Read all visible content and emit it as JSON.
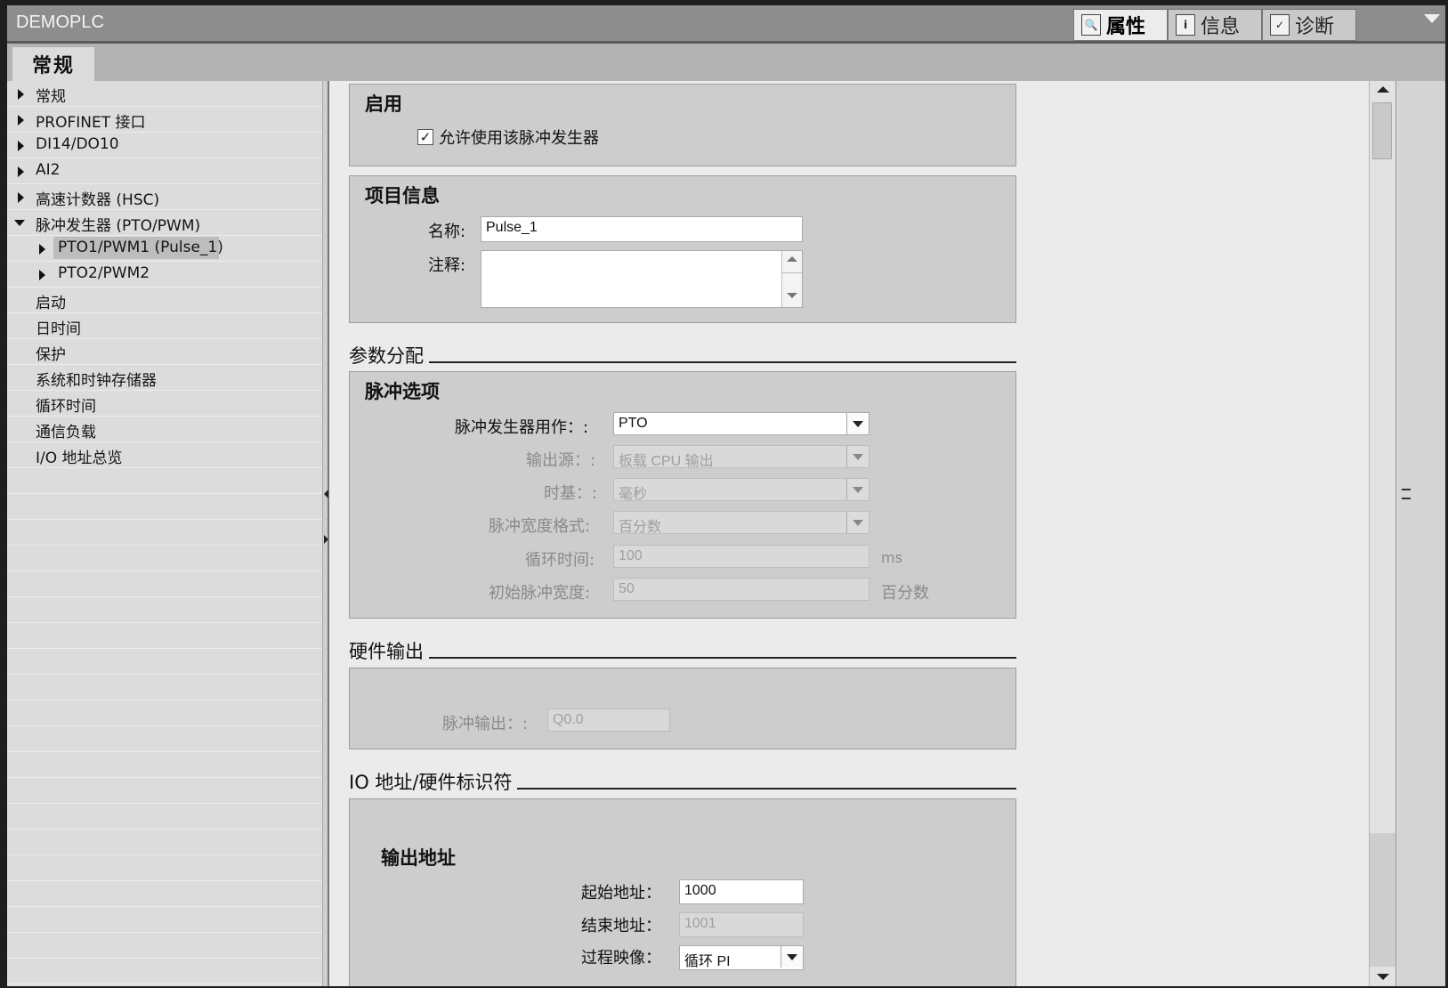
{
  "window": {
    "title": "DEMOPLC"
  },
  "inspector_tabs": [
    {
      "icon": "properties-icon",
      "label": "属性",
      "active": true
    },
    {
      "icon": "info-icon",
      "label": "信息",
      "active": false
    },
    {
      "icon": "diagnostics-icon",
      "label": "诊断",
      "active": false
    }
  ],
  "general_tab": {
    "label": "常规"
  },
  "sidebar": {
    "items": [
      {
        "label": "常规",
        "expander": "collapsed"
      },
      {
        "label": "PROFINET 接口",
        "expander": "collapsed"
      },
      {
        "label": "DI14/DO10",
        "expander": "collapsed"
      },
      {
        "label": "AI2",
        "expander": "collapsed"
      },
      {
        "label": "高速计数器 (HSC)",
        "expander": "collapsed"
      },
      {
        "label": "脉冲发生器 (PTO/PWM)",
        "expander": "expanded"
      },
      {
        "label": "PTO1/PWM1 (Pulse_1)",
        "expander": "collapsed",
        "selected": true
      },
      {
        "label": "PTO2/PWM2",
        "expander": "collapsed"
      },
      {
        "label": "启动"
      },
      {
        "label": "日时间"
      },
      {
        "label": "保护"
      },
      {
        "label": "系统和时钟存储器"
      },
      {
        "label": "循环时间"
      },
      {
        "label": "通信负载"
      },
      {
        "label": "I/O 地址总览"
      }
    ]
  },
  "enable_section": {
    "title": "启用",
    "checkbox_label": "允许使用该脉冲发生器",
    "checked": true
  },
  "project_info": {
    "title": "项目信息",
    "name_label": "名称:",
    "name_value": "Pulse_1",
    "comment_label": "注释:",
    "comment_value": ""
  },
  "parameter_assignment": {
    "header": "参数分配",
    "box_title": "脉冲选项",
    "fields": {
      "generator_use": {
        "label": "脉冲发生器用作：:",
        "value": "PTO"
      },
      "output_source": {
        "label": "输出源：:",
        "value": "板载 CPU 输出"
      },
      "time_base": {
        "label": "时基：:",
        "value": "毫秒"
      },
      "pulse_width_format": {
        "label": "脉冲宽度格式:",
        "value": "百分数"
      },
      "cycle_time": {
        "label": "循环时间:",
        "value": "100",
        "unit": "ms"
      },
      "initial_pulse_width": {
        "label": "初始脉冲宽度:",
        "value": "50",
        "unit": "百分数"
      }
    }
  },
  "hardware_output": {
    "header": "硬件输出",
    "pulse_output_label": "脉冲输出：:",
    "pulse_output_value": "Q0.0"
  },
  "io_address": {
    "header": "IO 地址/硬件标识符",
    "box_title": "输出地址",
    "start_label": "起始地址：",
    "start_value": "1000",
    "end_label": "结束地址：",
    "end_value": "1001",
    "process_image_label": "过程映像：",
    "process_image_value": "循环 PI"
  },
  "colors": {
    "titlebar": "#8d8d8d",
    "panel": "#cdcdcd",
    "content_bg": "#ebebeb",
    "sidebar_bg": "#dcdcdc"
  }
}
